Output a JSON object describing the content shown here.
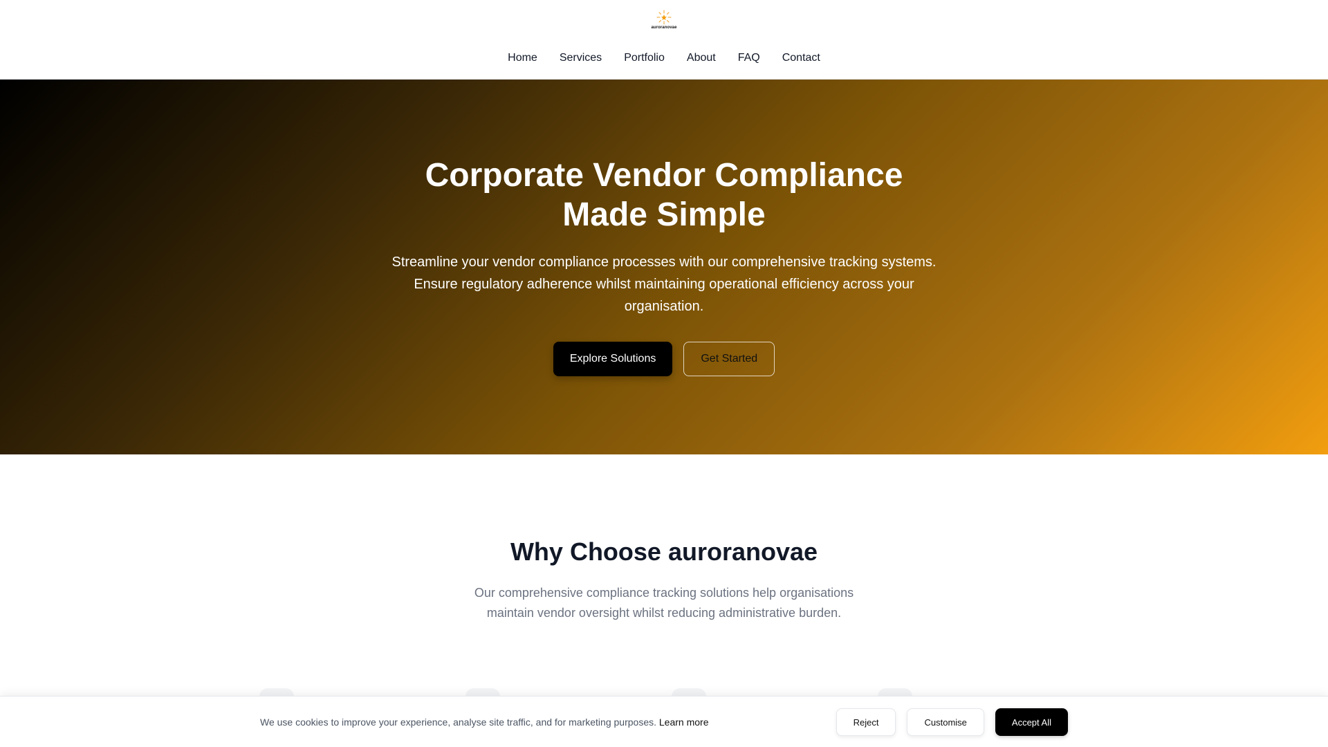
{
  "header": {
    "logo_text": "auroranovae",
    "nav": [
      "Home",
      "Services",
      "Portfolio",
      "About",
      "FAQ",
      "Contact"
    ]
  },
  "hero": {
    "title_line1": "Corporate Vendor Compliance",
    "title_line2": "Made Simple",
    "subtitle": "Streamline your vendor compliance processes with our comprehensive tracking systems. Ensure regulatory adherence whilst maintaining operational efficiency across your organisation.",
    "primary_button": "Explore Solutions",
    "secondary_button": "Get Started"
  },
  "why": {
    "title": "Why Choose auroranovae",
    "subtitle": "Our comprehensive compliance tracking solutions help organisations maintain vendor oversight whilst reducing administrative burden."
  },
  "cookie": {
    "text": "We use cookies to improve your experience, analyse site traffic, and for marketing purposes.",
    "learn_more": "Learn more",
    "reject": "Reject",
    "customise": "Customise",
    "accept": "Accept All"
  },
  "colors": {
    "accent": "#f29e0f",
    "dark": "#000000",
    "muted_text": "#6b7280"
  },
  "icons": {
    "logo": "sunburst-star-icon"
  }
}
